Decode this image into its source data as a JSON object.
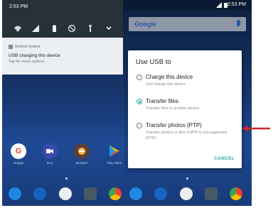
{
  "left_phone": {
    "clock": "2:53 PM",
    "quick_settings": [
      "wifi-icon",
      "signal-icon",
      "battery-icon",
      "dnd-icon",
      "flashlight-icon",
      "expand-chevron-icon"
    ],
    "notification": {
      "app": "Android System",
      "title": "USB charging this device",
      "subtitle": "Tap for more options."
    },
    "apps": [
      {
        "label": "Google",
        "icon": "google-icon"
      },
      {
        "label": "Duo",
        "icon": "duo-icon"
      },
      {
        "label": "Browser",
        "icon": "browser-icon"
      },
      {
        "label": "Play Store",
        "icon": "play-store-icon"
      }
    ],
    "dock": [
      "phone-icon",
      "messages-icon",
      "app-drawer-icon",
      "camera-icon",
      "chrome-icon"
    ]
  },
  "right_phone": {
    "clock": "2:53 PM",
    "search_placeholder": "Google",
    "dialog": {
      "title": "Use USB to",
      "options": [
        {
          "label": "Charge this device",
          "description": "Just charge this device",
          "selected": false
        },
        {
          "label": "Transfer files",
          "description": "Transfer files to another device",
          "selected": true
        },
        {
          "label": "Transfer photos (PTP)",
          "description": "Transfer photos or files if MTP is not supported (PTP)",
          "selected": false
        }
      ],
      "cancel_label": "CANCEL"
    },
    "dock": [
      "phone-icon",
      "messages-icon",
      "app-drawer-icon",
      "camera-icon",
      "chrome-icon"
    ]
  },
  "colors": {
    "accent": "#26a69a",
    "arrow": "#c62828",
    "shade": "#263238",
    "notification_bg": "#eceff1"
  }
}
